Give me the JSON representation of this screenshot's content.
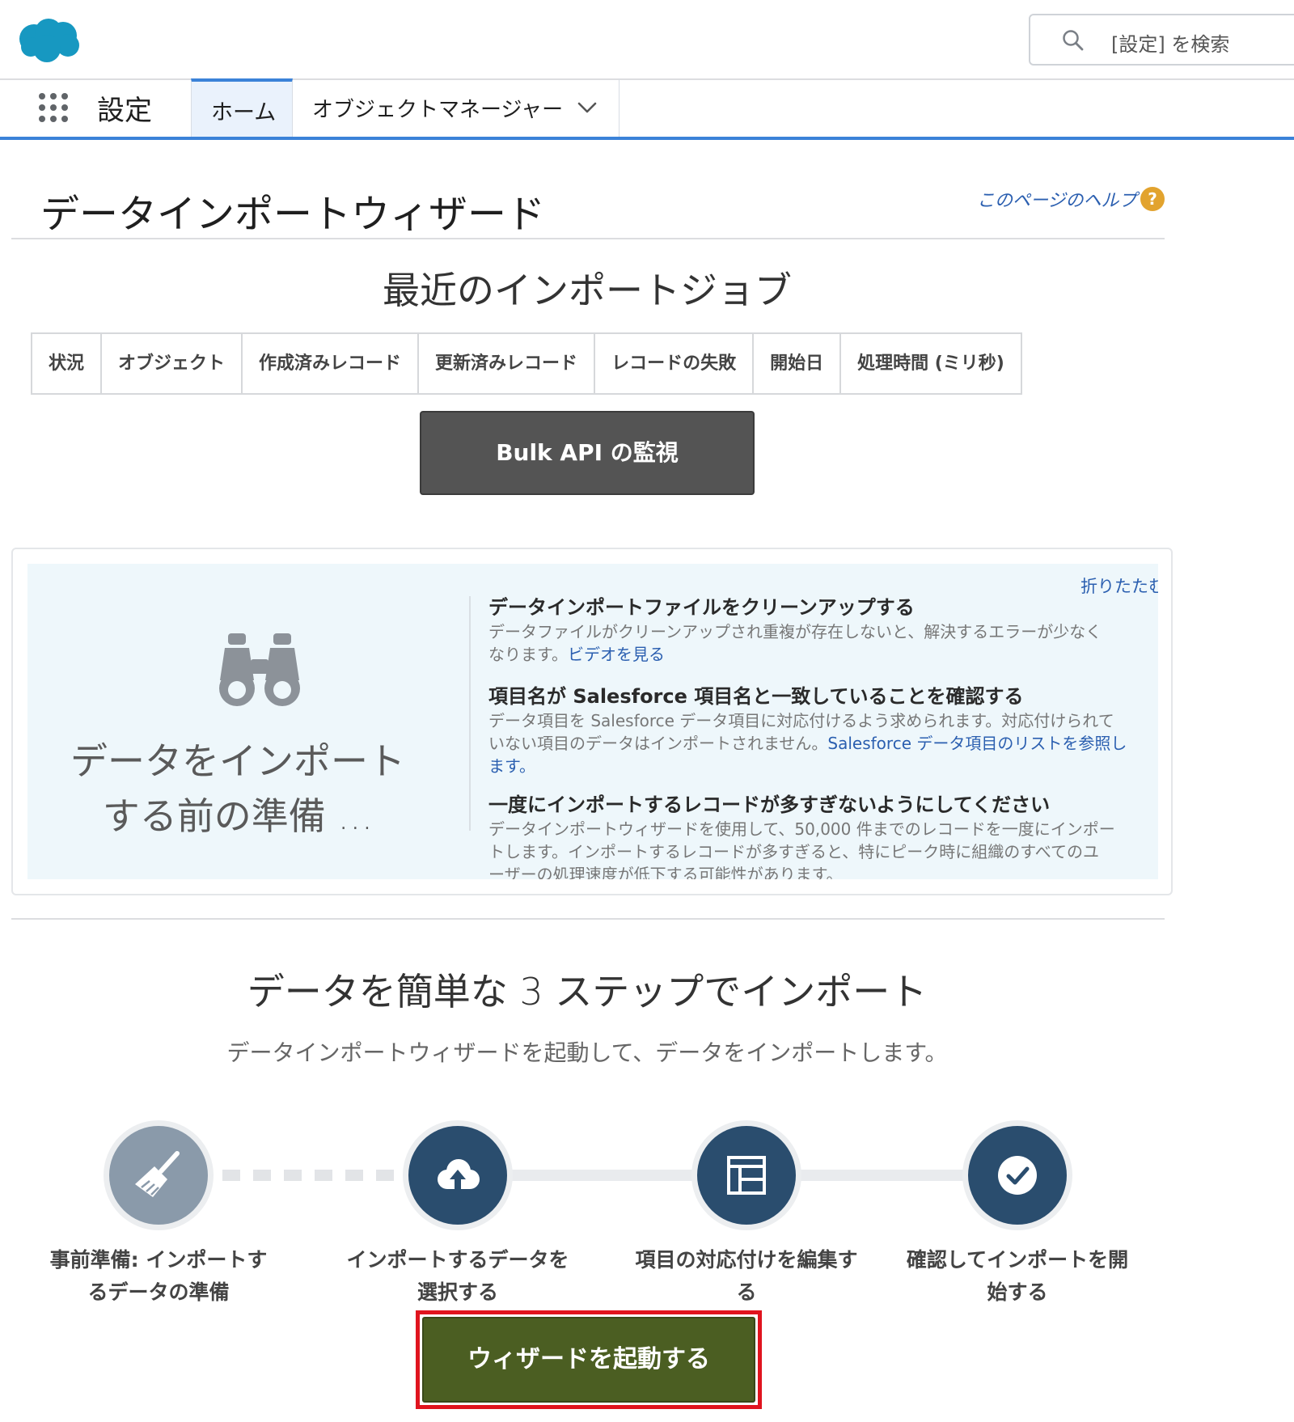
{
  "header": {
    "search_placeholder": "[設定] を検索"
  },
  "nav": {
    "app_title": "設定",
    "tabs": [
      {
        "label": "ホーム",
        "active": true
      },
      {
        "label": "オブジェクトマネージャー",
        "has_dropdown": true
      }
    ]
  },
  "page": {
    "title": "データインポートウィザード",
    "help_link": "このページのヘルプ",
    "help_icon_glyph": "?"
  },
  "recent_jobs": {
    "title": "最近のインポートジョブ",
    "columns": [
      "状況",
      "オブジェクト",
      "作成済みレコード",
      "更新済みレコード",
      "レコードの失敗",
      "開始日",
      "処理時間 (ミリ秒)"
    ],
    "bulk_button": "Bulk API の監視"
  },
  "prep": {
    "heading_line1": "データをインポート",
    "heading_line2": "する前の準備 ...",
    "collapse_link": "折りたたむ",
    "tips": [
      {
        "title": "データインポートファイルをクリーンアップする",
        "body_line1": "データファイルがクリーンアップされ重複が存在しないと、解決するエラーが少なく",
        "body_line2": "なります。",
        "link": "ビデオを見る"
      },
      {
        "title": "項目名が Salesforce 項目名と一致していることを確認する",
        "body_line1": "データ項目を Salesforce データ項目に対応付けるよう求められます。対応付けられて",
        "body_line2": "いない項目のデータはインポートされません。",
        "link_line2": "Salesforce データ項目のリストを参照し",
        "link_line3": "ます。"
      },
      {
        "title": "一度にインポートするレコードが多すぎないようにしてください",
        "body_line1": "データインポートウィザードを使用して、50,000 件までのレコードを一度にインポー",
        "body_line2": "トします。インポートするレコードが多すぎると、特にピーク時に組織のすべてのユ",
        "body_line3": "ーザーの処理速度が低下する可能性があります。"
      }
    ]
  },
  "steps": {
    "title": "データを簡単な 3 ステップでインポート",
    "subtitle": "データインポートウィザードを起動して、データをインポートします。",
    "items": [
      {
        "line1": "事前準備: インポートす",
        "line2": "るデータの準備",
        "icon": "broom-icon"
      },
      {
        "line1": "インポートするデータを",
        "line2": "選択する",
        "icon": "cloud-upload-icon"
      },
      {
        "line1": "項目の対応付けを編集す",
        "line2": "る",
        "icon": "layout-icon"
      },
      {
        "line1": "確認してインポートを開",
        "line2": "始する",
        "icon": "check-icon"
      }
    ],
    "start_button": "ウィザードを起動する"
  },
  "colors": {
    "brand_blue": "#1798c1",
    "nav_accent": "#3b82d8",
    "link": "#2b5fb0",
    "start_button": "#4b5e22",
    "bulk_button": "#545454",
    "highlight_outline": "#e0141e",
    "step_dark": "#2a4d6e",
    "step_muted": "#8a9aaa"
  }
}
